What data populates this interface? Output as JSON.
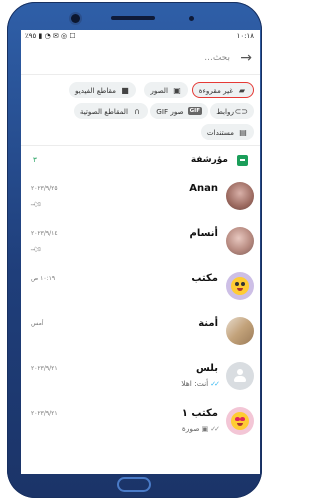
{
  "status": {
    "time": "١٠:١٨",
    "left_icons": "٪٩٥ ▮ ◔ ✉ ◎ ☐"
  },
  "search": {
    "placeholder": "بحث...",
    "value": ""
  },
  "chips": [
    {
      "label": "غير مقروءة",
      "icon": "unread-icon",
      "selected": true
    },
    {
      "label": "الصور",
      "icon": "image-icon",
      "selected": false
    },
    {
      "label": "مقاطع الفيديو",
      "icon": "video-icon",
      "selected": false
    },
    {
      "label": "روابط",
      "icon": "link-icon",
      "selected": false
    },
    {
      "label": "صور GIF",
      "icon": "gif-icon",
      "selected": false
    },
    {
      "label": "المقاطع الصوتية",
      "icon": "headphones-icon",
      "selected": false
    },
    {
      "label": "مستندات",
      "icon": "document-icon",
      "selected": false
    }
  ],
  "archived": {
    "label": "مؤرشفة",
    "count": "٣"
  },
  "chats": [
    {
      "name": "Anan",
      "date": "٢٠٢٣/٩/٢٥",
      "preview": "",
      "pinned": true
    },
    {
      "name": "أنسام",
      "date": "٢٠٢٣/٩/١٤",
      "preview": "",
      "pinned": true
    },
    {
      "name": "مكتب",
      "date": "١٠:١٩ ص",
      "preview": "",
      "pinned": false
    },
    {
      "name": "أمنة",
      "date": "أمس",
      "preview": "",
      "pinned": false
    },
    {
      "name": "بلس",
      "date": "٢٠٢٣/٩/٢١",
      "preview": "أنت: اهلا",
      "pinned": false
    },
    {
      "name": "مكتب ١",
      "date": "٢٠٢٣/٩/٢١",
      "preview": "صورة",
      "pinned": false
    }
  ],
  "colors": {
    "accent_green": "#1b9e5a",
    "selected_outline": "#e53935",
    "read_ticks": "#34b7f1",
    "phone_frame": "#2f5fa8"
  }
}
